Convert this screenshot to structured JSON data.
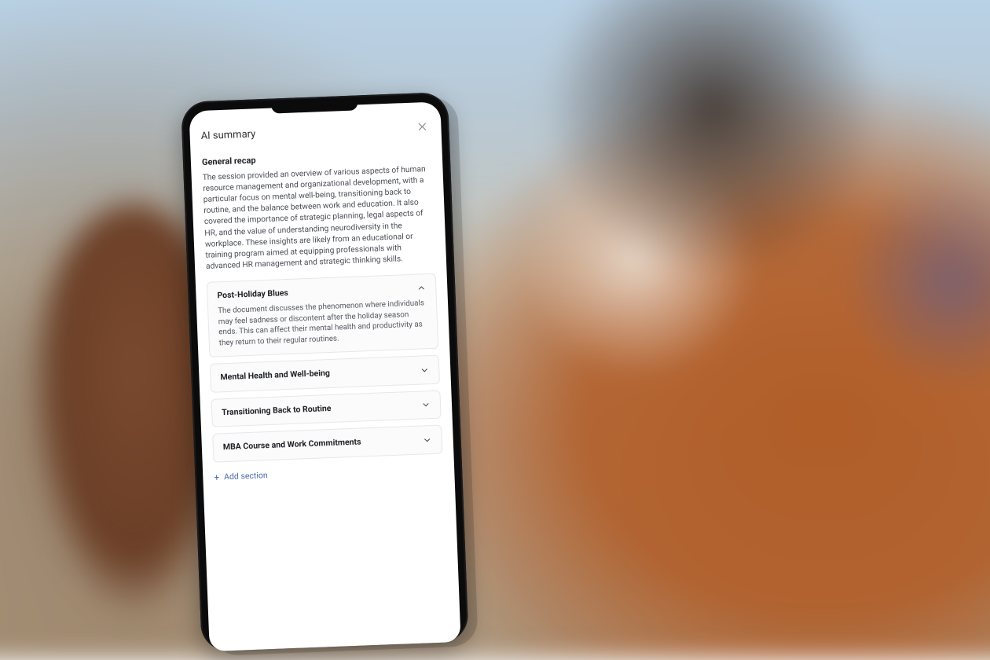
{
  "header": {
    "title": "AI summary"
  },
  "recap": {
    "title": "General recap",
    "text": "The session provided an overview of various aspects of human resource management and organizational development, with a particular focus on mental well-being, transitioning back to routine, and the balance between work and education. It also covered the importance of strategic planning, legal aspects of HR, and the value of understanding  neurodiversity in the workplace. These insights are likely from an  educational or training program aimed at equipping professionals with advanced HR management and strategic thinking skills."
  },
  "sections": {
    "s0": {
      "title": "Post-Holiday Blues",
      "expanded": true,
      "body": "The document discusses the phenomenon where individuals may feel sadness or discontent after the holiday season ends. This can affect their mental health and productivity as they return to their regular routines."
    },
    "s1": {
      "title": "Mental Health and Well-being",
      "expanded": false
    },
    "s2": {
      "title": "Transitioning Back to Routine",
      "expanded": false
    },
    "s3": {
      "title": "MBA Course and Work Commitments",
      "expanded": false
    }
  },
  "actions": {
    "add_section": "Add section"
  }
}
